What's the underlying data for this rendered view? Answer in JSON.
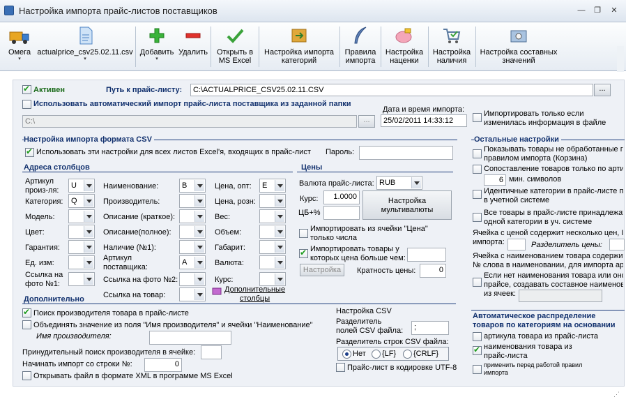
{
  "window": {
    "title": "Настройка импорта прайс-листов поставщиков",
    "min": "—",
    "restore": "❐",
    "close": "✕"
  },
  "toolbar": [
    {
      "key": "omega",
      "label": "Омега",
      "arrow": "▾",
      "icon": "truck-icon"
    },
    {
      "key": "file",
      "label": "actualprice_csv25.02.11.csv",
      "arrow": "▾",
      "icon": "file-icon"
    },
    {
      "key": "add",
      "label": "Добавить",
      "arrow": "▾",
      "icon": "plus-icon"
    },
    {
      "key": "delete",
      "label": "Удалить",
      "icon": "minus-icon"
    },
    {
      "key": "openexcel",
      "label": "Открыть в\nMS Excel",
      "icon": "checkmark-icon"
    },
    {
      "key": "catimport",
      "label": "Настройка импорта\nкатегорий",
      "icon": "category-icon"
    },
    {
      "key": "rules",
      "label": "Правила\nимпорта",
      "icon": "feather-icon"
    },
    {
      "key": "markup",
      "label": "Настройка\nнаценки",
      "icon": "piggy-icon"
    },
    {
      "key": "stock",
      "label": "Настройка\nналичия",
      "icon": "cart-icon"
    },
    {
      "key": "composite",
      "label": "Настройка составных\nзначений",
      "icon": "gear-box-icon"
    }
  ],
  "top": {
    "active_label": "Активен",
    "active": true,
    "path_label": "Путь к прайс-листу:",
    "path_value": "C:\\ACTUALPRICE_CSV25.02.11.CSV",
    "browse": "...",
    "auto_label": "Использовать автоматический импорт прайс-листа поставщика из заданной папки",
    "auto": false,
    "auto_path": "C:\\",
    "auto_browse": "...",
    "date_label": "Дата и время импорта:",
    "date_value": "25/02/2011 14:33:12",
    "only_changed_label": "Импортировать только если\nизменилась информация в файле",
    "only_changed": false
  },
  "csv": {
    "title": "Настройка импорта формата CSV",
    "use_all_label": "Использовать эти настройки для всех листов Excel'я, входящих в прайс-лист",
    "use_all": true,
    "password_label": "Пароль:",
    "password_value": ""
  },
  "columns": {
    "title": "Адреса столбцов",
    "col1": [
      {
        "label": "Артикул\nпроиз-ля:",
        "value": "U"
      },
      {
        "label": "Категория:",
        "value": "Q"
      },
      {
        "label": "Модель:",
        "value": ""
      },
      {
        "label": "Цвет:",
        "value": ""
      },
      {
        "label": "Гарантия:",
        "value": ""
      },
      {
        "label": "Ед. изм:",
        "value": ""
      },
      {
        "label": "Ссылка на\nфото №1:",
        "value": ""
      }
    ],
    "col2": [
      {
        "label": "Наименование:",
        "value": "B"
      },
      {
        "label": "Производитель:",
        "value": ""
      },
      {
        "label": "Описание (краткое):",
        "value": ""
      },
      {
        "label": "Описание(полное):",
        "value": ""
      },
      {
        "label": "Наличие (№1):",
        "value": ""
      },
      {
        "label": "Артикул\nпоставщика:",
        "value": "A"
      },
      {
        "label": "Ссылка на фото №2:",
        "value": ""
      },
      {
        "label": "Ссылка на товар:",
        "value": ""
      }
    ],
    "col3": [
      {
        "label": "Цена, опт:",
        "value": "E"
      },
      {
        "label": "Цена, розн:",
        "value": ""
      },
      {
        "label": "Вес:",
        "value": ""
      },
      {
        "label": "Объем:",
        "value": ""
      },
      {
        "label": "Габарит:",
        "value": ""
      },
      {
        "label": "Валюта:",
        "value": ""
      },
      {
        "label": "Курс:",
        "value": ""
      }
    ],
    "extra_cols": "Дополнительные\nстолбцы"
  },
  "prices": {
    "title": "Цены",
    "currency_label": "Валюта прайс-листа:",
    "currency_value": "RUB",
    "rate_label": "Курс:",
    "rate_value": "1.0000",
    "cb_label": "ЦБ+%",
    "cb_value": "",
    "multi_btn": "Настройка\nмультивалюты",
    "from_price_label": "Импортировать из ячейки \"Цена\"\nтолько числа",
    "from_price": false,
    "price_gt_label": "Импортировать товары у\nкоторых цена больше чем:",
    "price_gt": true,
    "price_gt_value": "",
    "setup_btn": "Настройка",
    "multiplicity_label": "Кратность цены:",
    "multiplicity_value": "0"
  },
  "extra": {
    "title": "Дополнительно",
    "search_mfr_label": "Поиск производителя товара в прайс-листе",
    "search_mfr": true,
    "merge_label": "Объединять значение из поля \"Имя производителя\" и ячейки \"Наименование\"",
    "merge": false,
    "mfr_name_label": "Имя производителя:",
    "mfr_name_value": "",
    "forced_label": "Принудительный поиск производителя в ячейке:",
    "forced_value": "",
    "start_row_label": "Начинать импорт со строки №:",
    "start_row_value": "0",
    "xml_label": "Открывать файл в формате XML в программе MS Excel",
    "xml": false
  },
  "csvset": {
    "title": "Настройка CSV",
    "field_sep_label": "Разделитель\nполей CSV файла:",
    "field_sep_value": ";",
    "row_sep_label": "Разделитель строк CSV файла:",
    "options": [
      "Нет",
      "{LF}",
      "{CRLF}"
    ],
    "selected": 0,
    "utf8_label": "Прайс-лист в кодировке UTF-8",
    "utf8": false
  },
  "other": {
    "title": "Остальные настройки",
    "items": [
      {
        "label": "Показывать товары не обработанные г\nправилом импорта (Корзина)",
        "checked": false
      },
      {
        "label": "Сопоставление товаров только по арти",
        "checked": false
      },
      {
        "label": "Идентичные категории в прайс-листе п\nв учетной системе",
        "checked": false
      },
      {
        "label": "Все товары в прайс-листе принадлежат\nодной категории в уч. системе",
        "checked": false
      },
      {
        "label": "Если нет наименования товара или оно\nпрайсе, создавать составное наименов\nиз ячеек:",
        "checked": false
      }
    ],
    "chars_value": "6",
    "chars_label": "мин. символов",
    "multi_price_label": "Ячейка с ценой содержит несколько цен, I\nимпорта:",
    "multi_price_value": "",
    "price_sep_label": "Разделитель цены:",
    "price_sep_value": "",
    "name_word_label": "Ячейка с наименованием товара содержит\n№ слова в наименовании, для импорта арт",
    "name_word_value": ""
  },
  "auto": {
    "title": "Автоматическое распределение\nтоваров по категориям на основании",
    "items": [
      {
        "label": "артикула товара из прайс-листа",
        "checked": false
      },
      {
        "label": "наименования товара из\nпрайс-листа",
        "checked": true
      },
      {
        "label": "применить перед работой правил\nимпорта",
        "checked": false
      }
    ]
  }
}
